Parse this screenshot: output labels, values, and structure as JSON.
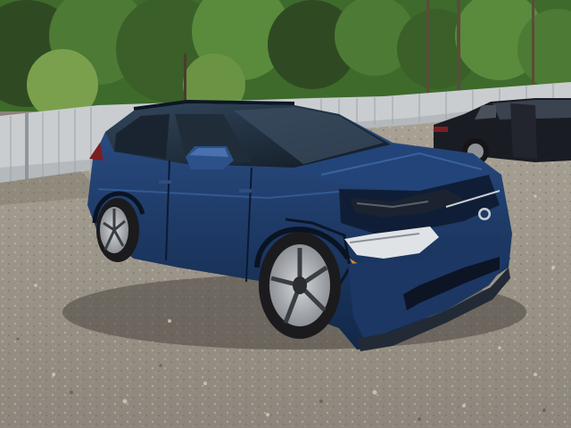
{
  "photo": {
    "subject": "damaged-suv",
    "colors": {
      "sky": "#dfe6e8",
      "foliage_dark": "#2f4a22",
      "foliage_mid": "#4d7a34",
      "foliage_light": "#7aa04e",
      "fence": "#c9cdd0",
      "fence_shadow": "#9ea4a8",
      "gravel": "#9d968b",
      "gravel_light": "#c2bcb2",
      "car_body": "#1e3a66",
      "car_body_dark": "#112544",
      "car_highlight": "#3d6aa8",
      "glass": "#1a2430",
      "tire": "#1b1b1d",
      "rim": "#b9bcc0",
      "background_car": "#1a1c24"
    }
  }
}
